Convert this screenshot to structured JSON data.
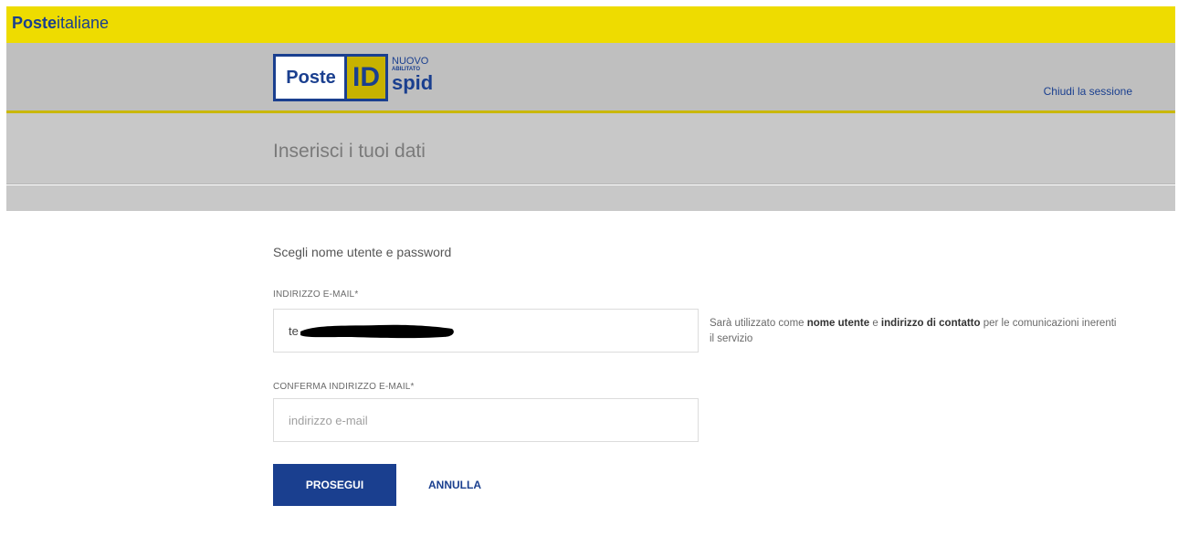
{
  "brand": {
    "bold": "Poste",
    "thin": "italiane"
  },
  "logo": {
    "poste": "Poste",
    "id": "ID",
    "nuovo": "NUOVO",
    "abil": "ABILITATO",
    "spid": "spid"
  },
  "header": {
    "session_link": "Chiudi la sessione"
  },
  "page": {
    "title": "Inserisci i tuoi dati"
  },
  "form": {
    "section_title": "Scegli nome utente e password",
    "email_label": "INDIRIZZO E-MAIL*",
    "email_value": "te",
    "confirm_label": "CONFERMA INDIRIZZO E-MAIL*",
    "confirm_placeholder": "indirizzo e-mail",
    "helper_pre": "Sarà utilizzato come ",
    "helper_b1": "nome utente",
    "helper_mid": " e ",
    "helper_b2": "indirizzo di contatto",
    "helper_post": " per le comunicazioni inerenti il servizio"
  },
  "actions": {
    "primary": "PROSEGUI",
    "secondary": "ANNULLA"
  },
  "colors": {
    "yellow": "#eedc00",
    "blue": "#1a3f8f",
    "gray": "#c8c8c8"
  }
}
